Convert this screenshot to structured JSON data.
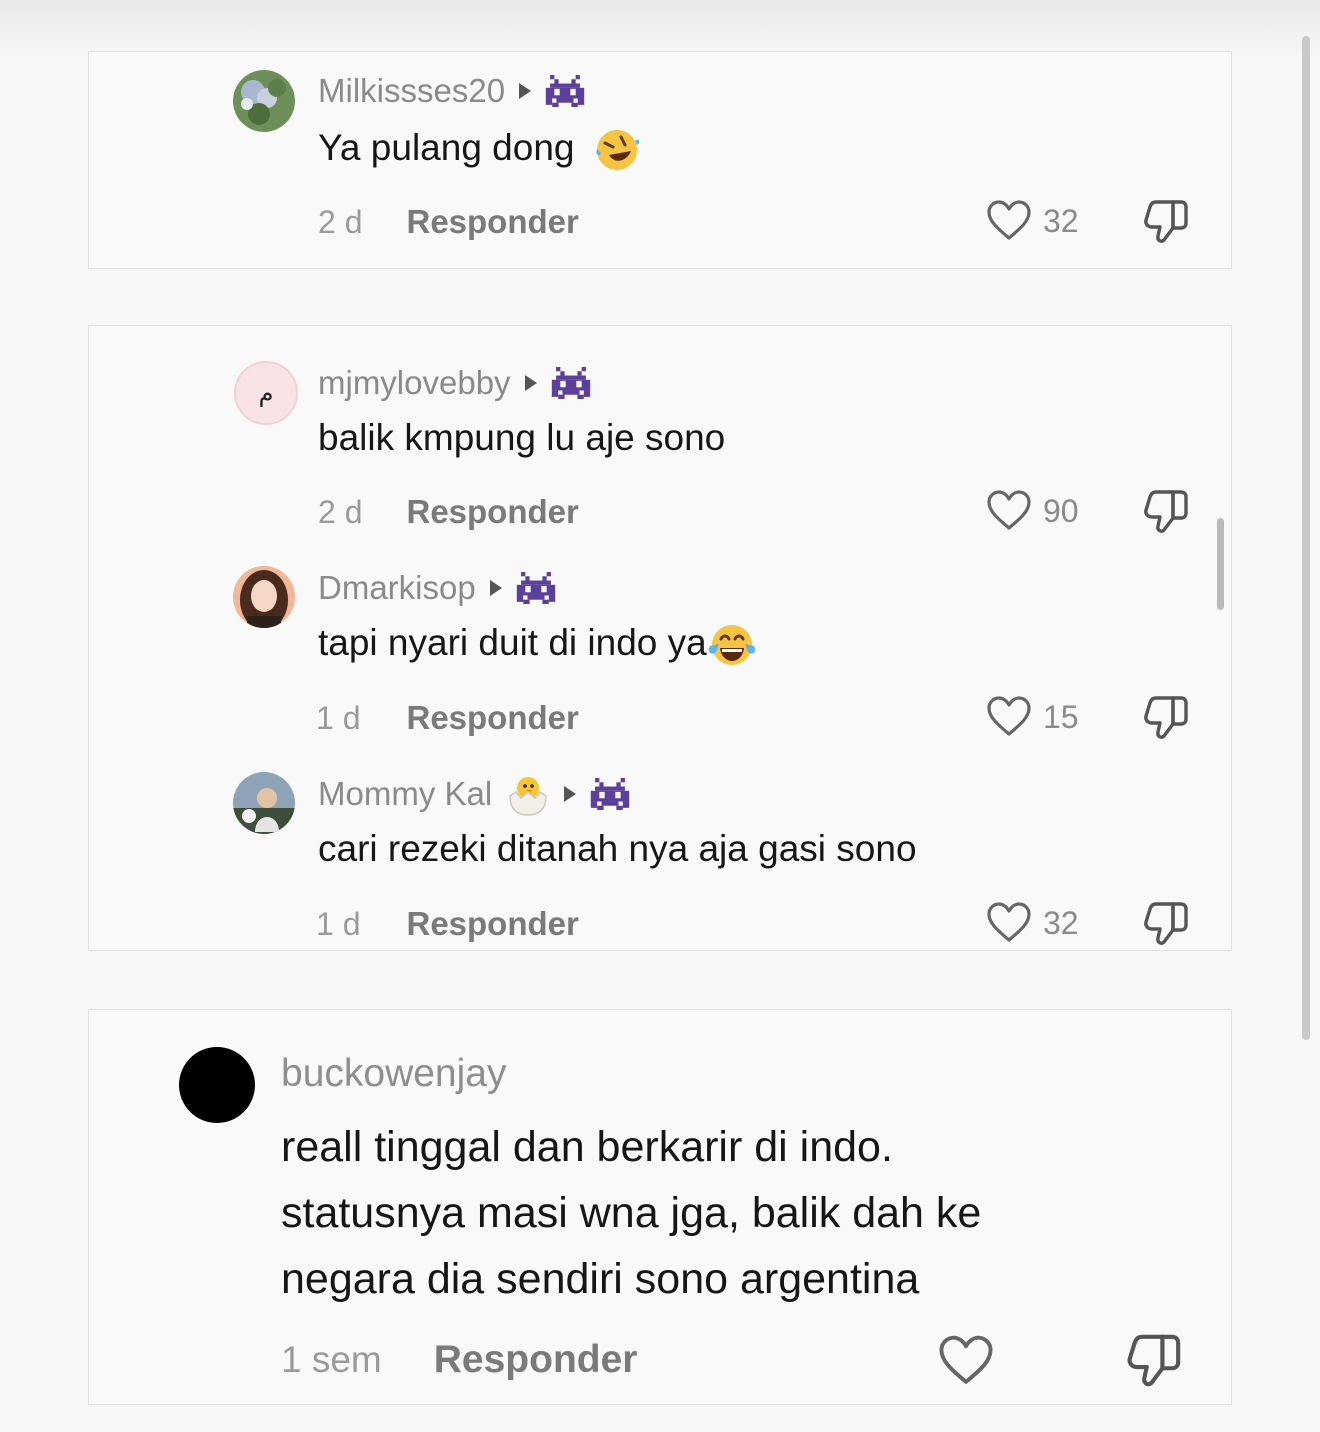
{
  "comments": [
    {
      "username": "Milkissses20",
      "text": "Ya pulang dong",
      "emoji": "rolling-on-floor-laughing",
      "time": "2 d",
      "reply": "Responder",
      "likes": "32"
    },
    {
      "username": "mjmylovebby",
      "text": "balik kmpung lu aje sono",
      "time": "2 d",
      "reply": "Responder",
      "likes": "90",
      "avatar_letter": " م"
    },
    {
      "username": "Dmarkisop",
      "text": "tapi nyari duit di indo ya",
      "emoji": "tears-of-joy",
      "time": "1 d",
      "reply": "Responder",
      "likes": "15"
    },
    {
      "username": "Mommy Kal",
      "name_emoji": "hatching-chick",
      "text": "cari rezeki ditanah nya aja gasi sono",
      "time": "1 d",
      "reply": "Responder",
      "likes": "32"
    },
    {
      "username": "buckowenjay",
      "text_lines": [
        "reall tinggal dan berkarir di indo.",
        "statusnya masi wna jga, balik dah ke",
        "negara dia sendiri sono argentina"
      ],
      "time": "1 sem",
      "reply": "Responder"
    }
  ],
  "icons": {
    "badge": "space-invader-icon",
    "play": "play-icon",
    "like": "heart-outline-icon",
    "dislike": "thumbs-down-icon"
  },
  "colors": {
    "username": "#8a8a8a",
    "text": "#161616",
    "badge": "#5b3f9a"
  }
}
